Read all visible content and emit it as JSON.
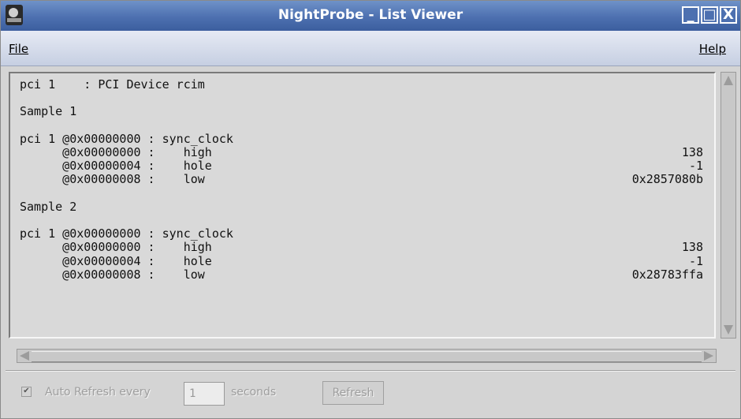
{
  "window": {
    "title": "NightProbe - List Viewer"
  },
  "menubar": {
    "file": "File",
    "help": "Help"
  },
  "list": {
    "lines": [
      "pci 1    : PCI Device rcim",
      "",
      "Sample 1",
      "",
      "pci 1 @0x00000000 : sync_clock",
      "      @0x00000000 :    high",
      "      @0x00000004 :    hole",
      "      @0x00000008 :    low",
      "",
      "Sample 2",
      "",
      "pci 1 @0x00000000 : sync_clock",
      "      @0x00000000 :    high",
      "      @0x00000004 :    hole",
      "      @0x00000008 :    low"
    ],
    "values": [
      "",
      "",
      "",
      "",
      "",
      "138",
      "-1",
      "0x2857080b",
      "",
      "",
      "",
      "",
      "138",
      "-1",
      "0x28783ffa"
    ]
  },
  "controls": {
    "auto_refresh_label": "Auto Refresh every",
    "auto_refresh_checked": true,
    "interval_value": "1",
    "seconds_label": "seconds",
    "refresh_button": "Refresh"
  },
  "icons": {
    "app": "nightprobe-app-icon",
    "minimize": "minimize-icon",
    "maximize": "maximize-icon",
    "close": "close-icon"
  }
}
